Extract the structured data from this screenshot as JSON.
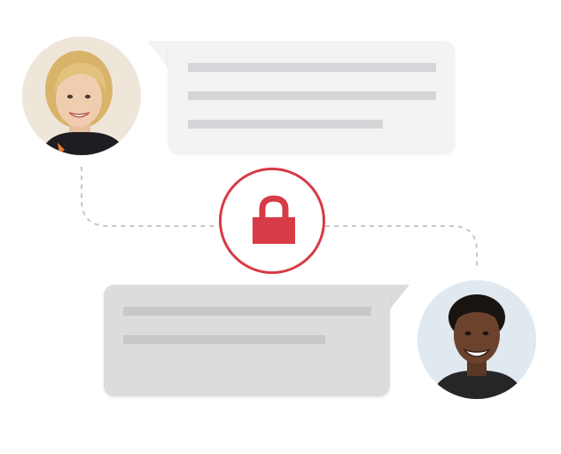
{
  "scene": {
    "lock_color": "#d63b46",
    "bubble_top_color": "#f3f3f4",
    "bubble_bottom_color": "#dcdcdd",
    "placeholder_line_color": "#d6d6d9",
    "connector_color": "#c7c7c7"
  },
  "participants": [
    {
      "role": "sender",
      "position": "top-left",
      "icon": "avatar-woman"
    },
    {
      "role": "recipient",
      "position": "bottom-right",
      "icon": "avatar-man"
    }
  ],
  "messages": [
    {
      "from": "sender",
      "placeholder_lines": 3
    },
    {
      "from": "recipient",
      "placeholder_lines": 2
    }
  ],
  "center_icon": "lock-icon"
}
